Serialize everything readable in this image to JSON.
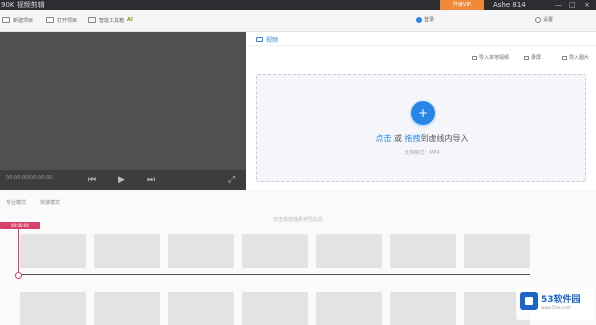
{
  "titlebar": {
    "title": "90K 视频剪辑",
    "upgrade_label": "升级VIP",
    "user": "Ashe 814",
    "minimize": "—",
    "restore": "□",
    "close": "×"
  },
  "toolbar": {
    "items": [
      {
        "label": "新建项目",
        "icon": "new-project-icon"
      },
      {
        "label": "打开项目",
        "icon": "open-project-icon"
      },
      {
        "label": "智能工具箱",
        "icon": "ai-toolbox-icon",
        "badge": "AI"
      }
    ],
    "right_a": "登录",
    "right_b": "设置"
  },
  "preview": {
    "time": "00:00:00/00:00:00",
    "prev": "⏮",
    "play": "▶",
    "next": "⏭",
    "fullscreen": "⤢"
  },
  "media": {
    "tab_label": "视频",
    "actions": [
      "导入本地视频",
      "录屏",
      "导入图片"
    ],
    "drop_prefix": "点击",
    "drop_or": "或",
    "drop_highlight": "拖拽",
    "drop_suffix": "到虚线内导入",
    "drop_sub": "支持格式：MP4"
  },
  "timeline": {
    "tabs": [
      "专业模式",
      "快速模式"
    ],
    "hint": "双击或拖拽素材至此处",
    "playhead_time": "00:00:00"
  },
  "watermark": {
    "name": "53软件园",
    "url": "www.53xt.com"
  },
  "colors": {
    "accent": "#2a86e6",
    "playhead": "#d8426a",
    "upgrade": "#f0893a"
  }
}
